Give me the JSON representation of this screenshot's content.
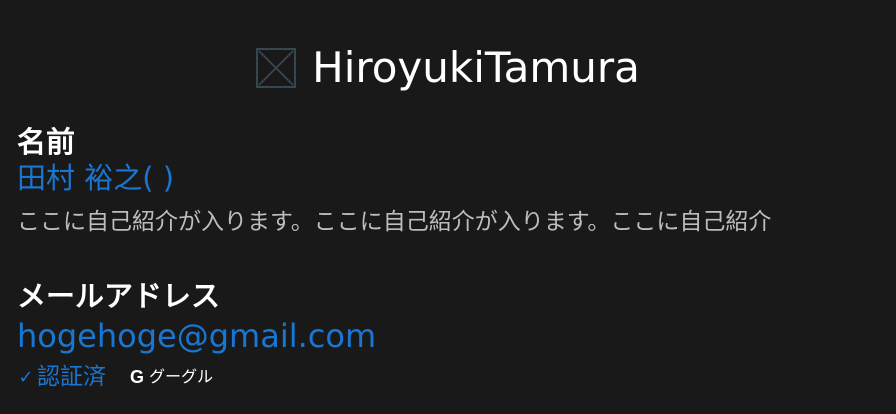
{
  "header": {
    "title": "HiroyukiTamura",
    "avatar_icon": "broken-image-icon"
  },
  "profile": {
    "name_label": "名前",
    "name_value": "田村 裕之( )",
    "description": "ここに自己紹介が入ります。ここに自己紹介が入ります。ここに自己紹介",
    "email_label": "メールアドレス",
    "email": "hogehoge@gmail.com",
    "verified_label": "認証済",
    "provider_label": "グーグル"
  },
  "colors": {
    "background": "#191919",
    "accent": "#1976d2",
    "text": "#ffffff",
    "muted": "#bdbdbd"
  }
}
